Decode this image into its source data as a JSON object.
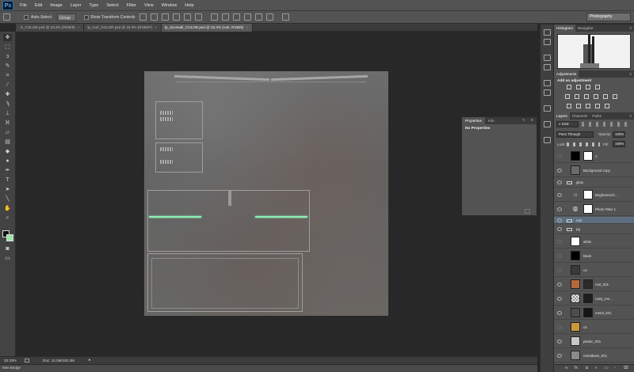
{
  "menubar": {
    "logo": "Ps",
    "items": [
      "File",
      "Edit",
      "Image",
      "Layer",
      "Type",
      "Select",
      "Filter",
      "View",
      "Window",
      "Help"
    ]
  },
  "options": {
    "auto_select_label": "Auto-Select:",
    "auto_select_target": "Group",
    "transform_label": "Show Transform Controls",
    "workspace": "Photography"
  },
  "documents": [
    {
      "label": "..k_COLOR.psd @ 33.3% (RGB/8)",
      "active": false
    },
    {
      "label": "lp_roof_COLOR.psd @ 33.3% (RGB/8*)",
      "active": false
    },
    {
      "label": "lp_doorwall_COLOR.psd @ 33.3% (rust, RGB/8)",
      "active": true
    }
  ],
  "status": {
    "zoom": "33.33%",
    "doc_info": "Doc: 12.0M/163.3M"
  },
  "bottom_panel": "Mini Bridge",
  "properties_panel": {
    "tabs": [
      "Properties",
      "Info"
    ],
    "content": "No Properties"
  },
  "histogram_panel": {
    "tabs": [
      "Histogram",
      "Navigator"
    ]
  },
  "adjustments_panel": {
    "tabs": [
      "Adjustments"
    ],
    "heading": "Add an adjustment"
  },
  "layers_panel": {
    "tabs": [
      "Layers",
      "Channels",
      "Paths"
    ],
    "filter_kind": "Kind",
    "blend_mode": "Pass Through",
    "opacity_label": "Opacity:",
    "opacity_value": "100%",
    "lock_label": "Lock:",
    "fill_label": "Fill:",
    "fill_value": "100%",
    "layers": [
      {
        "name": "1",
        "kind": "image",
        "visible": false,
        "thumb": "#000000",
        "mask": true
      },
      {
        "name": "Background copy",
        "kind": "image",
        "visible": true,
        "thumb": "#6a6a6a",
        "mask": false
      },
      {
        "name": "glow",
        "kind": "group",
        "visible": true
      },
      {
        "name": "Brightness/C...",
        "kind": "adjustment",
        "visible": true,
        "mask": true
      },
      {
        "name": "Photo Filter 1",
        "kind": "adjustment",
        "visible": true,
        "mask": true
      },
      {
        "name": "rust",
        "kind": "group",
        "visible": true,
        "selected": true
      },
      {
        "name": "pg",
        "kind": "group",
        "visible": true,
        "open": true
      },
      {
        "name": "white",
        "kind": "image",
        "visible": false,
        "thumb": "#ffffff"
      },
      {
        "name": "black",
        "kind": "image",
        "visible": false,
        "thumb": "#000000"
      },
      {
        "name": "c4",
        "kind": "image",
        "visible": false,
        "thumb": "#3a3a3a"
      },
      {
        "name": "rust_001",
        "kind": "image",
        "visible": true,
        "thumb": "#b5693a",
        "mask": true,
        "mask_color": "#2a2a2a"
      },
      {
        "name": "rusty_me...",
        "kind": "image",
        "visible": true,
        "thumb": "#cfcfcf",
        "mask": true,
        "mask_color": "#1e1e1e"
      },
      {
        "name": "metal_001",
        "kind": "image",
        "visible": true,
        "thumb": "#4d4d4d",
        "mask": true,
        "mask_color": "#151515"
      },
      {
        "name": "c5",
        "kind": "image",
        "visible": false,
        "thumb": "#c8983a"
      },
      {
        "name": "plastic_001",
        "kind": "image",
        "visible": true,
        "thumb": "#c9c9c9"
      },
      {
        "name": "metalbase_001",
        "kind": "image",
        "visible": true,
        "thumb": "#8a8a8a"
      }
    ]
  },
  "colors": {
    "foreground": "#111111",
    "background": "#98e7a9",
    "glow": "#8cf0b4"
  }
}
